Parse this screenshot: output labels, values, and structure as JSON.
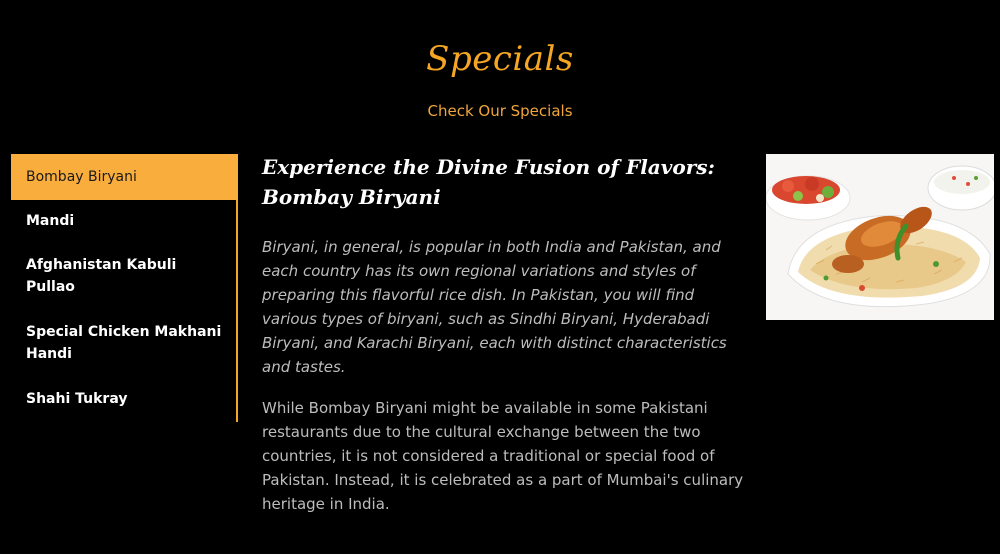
{
  "section": {
    "title": "Specials",
    "subtitle": "Check Our Specials"
  },
  "tabs": [
    {
      "label": "Bombay Biryani",
      "active": true
    },
    {
      "label": "Mandi",
      "active": false
    },
    {
      "label": "Afghanistan Kabuli Pullao",
      "active": false
    },
    {
      "label": "Special Chicken Makhani Handi",
      "active": false
    },
    {
      "label": "Shahi Tukray",
      "active": false
    }
  ],
  "content": {
    "title": "Experience the Divine Fusion of Flavors: Bombay Biryani",
    "paragraph_italic": "Biryani, in general, is popular in both India and Pakistan, and each country has its own regional variations and styles of preparing this flavorful rice dish. In Pakistan, you will find various types of biryani, such as Sindhi Biryani, Hyderabadi Biryani, and Karachi Biryani, each with distinct characteristics and tastes.",
    "paragraph": "While Bombay Biryani might be available in some Pakistani restaurants due to the cultural exchange between the two countries, it is not considered a traditional or special food of Pakistan. Instead, it is celebrated as a part of Mumbai's culinary heritage in India."
  },
  "image": {
    "icon": "biryani-dish-photo"
  },
  "colors": {
    "background": "#000000",
    "accent": "#f5a623",
    "active_tab_bg": "#f9ad3c",
    "text_muted": "#bdbdbd"
  }
}
